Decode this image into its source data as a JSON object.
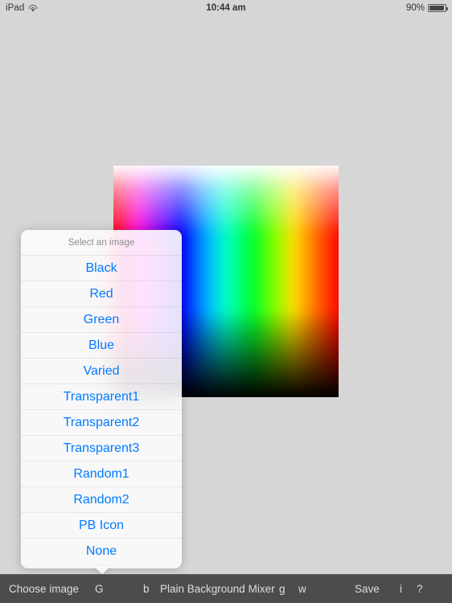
{
  "status_bar": {
    "device": "iPad",
    "wifi_icon": "wifi-icon",
    "time": "10:44 am",
    "battery_percent": "90%",
    "battery_icon": "battery-icon"
  },
  "canvas": {
    "image_name": "plain-background-gradient-preview"
  },
  "popover": {
    "title": "Select an image",
    "items": [
      {
        "label": "Black"
      },
      {
        "label": "Red"
      },
      {
        "label": "Green"
      },
      {
        "label": "Blue"
      },
      {
        "label": "Varied"
      },
      {
        "label": "Transparent1"
      },
      {
        "label": "Transparent2"
      },
      {
        "label": "Transparent3"
      },
      {
        "label": "Random1"
      },
      {
        "label": "Random2"
      },
      {
        "label": "PB Icon"
      },
      {
        "label": "None"
      }
    ]
  },
  "toolbar": {
    "choose_image": "Choose image",
    "g_button": "G",
    "b_button": "b",
    "app_title": "Plain Background Mixer",
    "g_lower_button": "g",
    "w_button": "w",
    "save_button": "Save",
    "info_button": "i",
    "help_button": "?"
  },
  "colors": {
    "background": "#d6d6d6",
    "toolbar": "#4c4c4c",
    "accent_blue": "#007aff",
    "header_gray": "#8e8e93"
  }
}
